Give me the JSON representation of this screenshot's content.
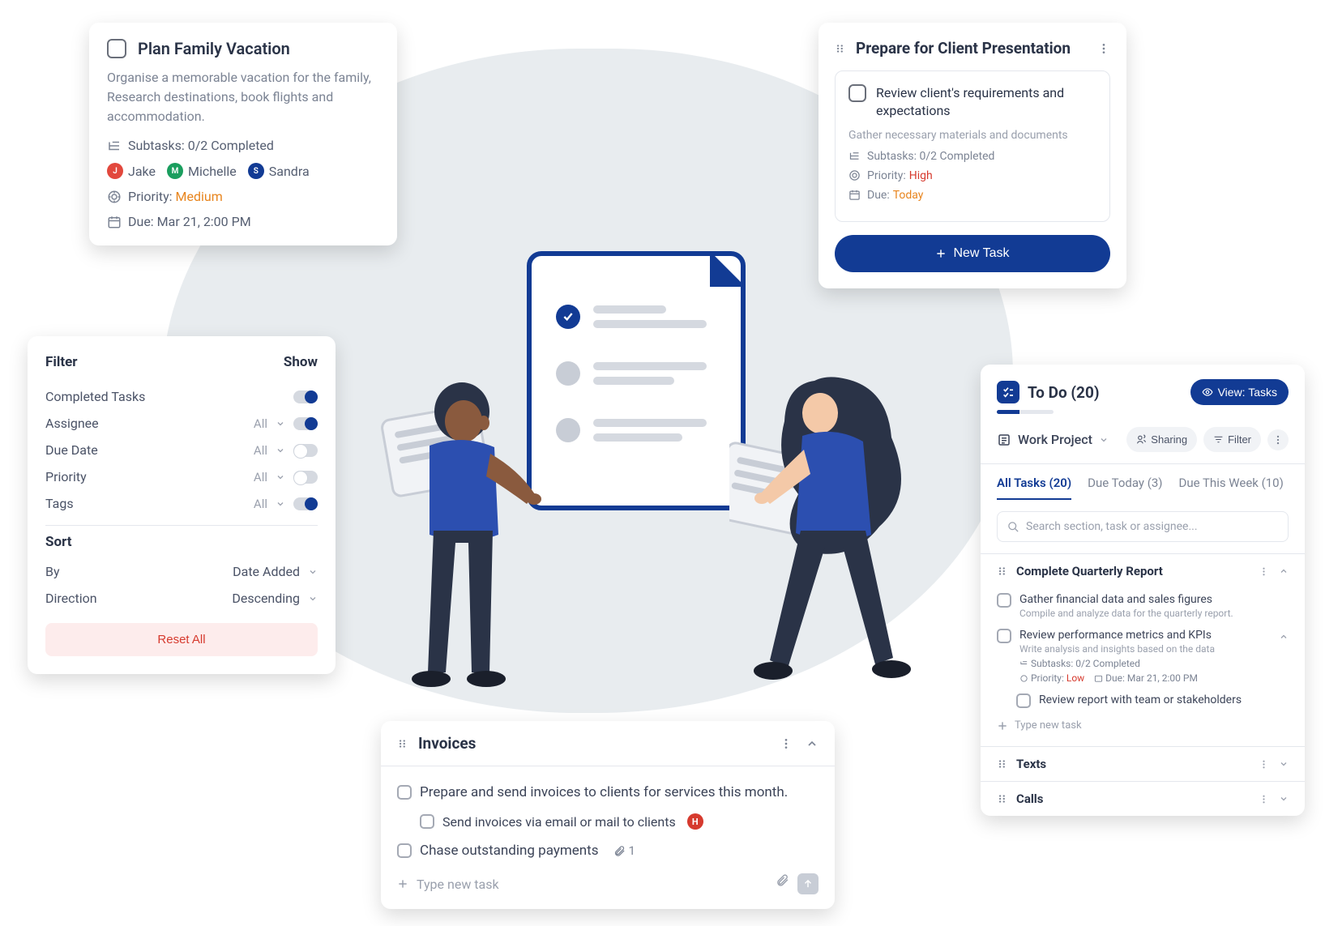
{
  "card1": {
    "title": "Plan Family Vacation",
    "desc": "Organise a memorable vacation for the family, Research destinations, book flights and accommodation.",
    "subtasks_label": "Subtasks: 0/2 Completed",
    "assignees": [
      {
        "initial": "J",
        "name": "Jake",
        "color": "red"
      },
      {
        "initial": "M",
        "name": "Michelle",
        "color": "green"
      },
      {
        "initial": "S",
        "name": "Sandra",
        "color": "blue"
      }
    ],
    "priority_label": "Priority:",
    "priority_value": "Medium",
    "due_label": "Due: Mar 21, 2:00 PM"
  },
  "card2": {
    "filter_label": "Filter",
    "show_label": "Show",
    "rows": [
      {
        "label": "Completed Tasks",
        "right": "",
        "toggle": "on"
      },
      {
        "label": "Assignee",
        "right": "All",
        "toggle": "on",
        "chevron": true
      },
      {
        "label": "Due Date",
        "right": "All",
        "toggle": "off",
        "chevron": true
      },
      {
        "label": "Priority",
        "right": "All",
        "toggle": "off",
        "chevron": true
      },
      {
        "label": "Tags",
        "right": "All",
        "toggle": "on",
        "chevron": true
      }
    ],
    "sort_label": "Sort",
    "sort_by_label": "By",
    "sort_by_value": "Date Added",
    "sort_dir_label": "Direction",
    "sort_dir_value": "Descending",
    "reset_label": "Reset All"
  },
  "card3": {
    "title": "Invoices",
    "tasks": [
      {
        "text": "Prepare and send invoices to clients for services this month.",
        "indent": 0
      },
      {
        "text": "Send invoices via email or mail to clients",
        "indent": 1,
        "badge": "H"
      },
      {
        "text": "Chase outstanding payments",
        "indent": 0,
        "attach": "1"
      }
    ],
    "new_task_placeholder": "Type new task"
  },
  "card4": {
    "title": "Prepare for Client Presentation",
    "subtask": {
      "title": "Review client's requirements and expectations",
      "desc": "Gather necessary materials and documents",
      "subtasks_label": "Subtasks: 0/2 Completed",
      "priority_label": "Priority:",
      "priority_value": "High",
      "due_label": "Due:",
      "due_value": "Today"
    },
    "new_task_btn": "New Task"
  },
  "card5": {
    "title": "To Do (20)",
    "view_btn": "View: Tasks",
    "project_label": "Work Project",
    "sharing": "Sharing",
    "filter": "Filter",
    "tabs": [
      {
        "label": "All Tasks (20)",
        "active": true
      },
      {
        "label": "Due Today (3)",
        "active": false
      },
      {
        "label": "Due This Week (10)",
        "active": false
      }
    ],
    "search_placeholder": "Search section, task or assignee...",
    "section1": {
      "title": "Complete Quarterly Report",
      "tasks": [
        {
          "title": "Gather financial data and sales figures",
          "desc": "Compile and analyze data for the quarterly report."
        },
        {
          "title": "Review performance metrics and KPIs",
          "desc": "Write analysis and insights based on the data",
          "subtasks": "Subtasks: 0/2 Completed",
          "priority_label": "Priority:",
          "priority": "Low",
          "due_label": "Due: Mar 21, 2:00 PM",
          "expanded": true,
          "nested": [
            {
              "title": "Review report with team or stakeholders"
            }
          ]
        }
      ],
      "new_task_placeholder": "Type new task"
    },
    "section2": {
      "title": "Texts"
    },
    "section3": {
      "title": "Calls"
    }
  }
}
